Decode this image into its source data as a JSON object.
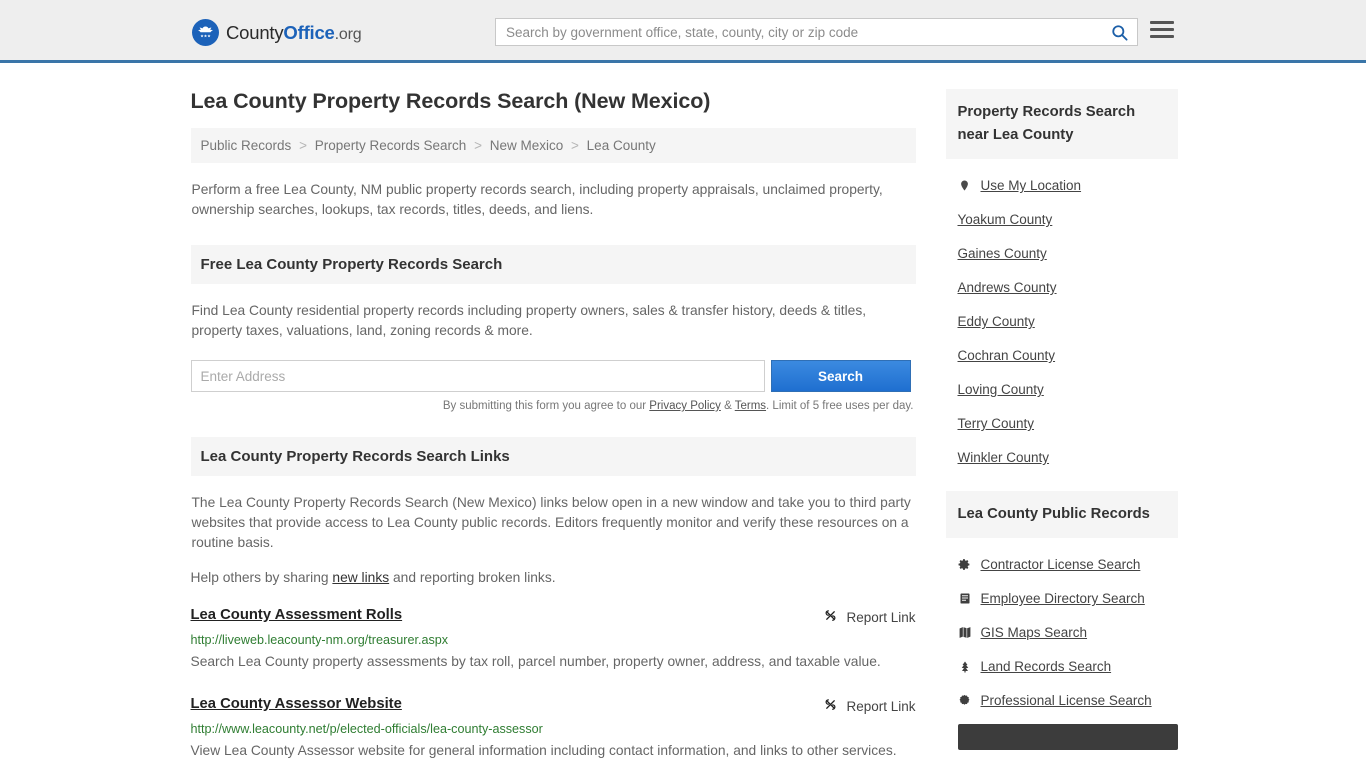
{
  "header": {
    "brand": {
      "part1": "County",
      "part2": "Office",
      "part3": ".org",
      "logo_icon": "eagle-seal-icon"
    },
    "search": {
      "placeholder": "Search by government office, state, county, city or zip code",
      "value": "",
      "icon": "search-icon"
    },
    "menu_icon": "hamburger-menu-icon"
  },
  "main": {
    "title": "Lea County Property Records Search (New Mexico)",
    "breadcrumb": [
      {
        "label": "Public Records"
      },
      {
        "label": "Property Records Search"
      },
      {
        "label": "New Mexico"
      },
      {
        "label": "Lea County"
      }
    ],
    "breadcrumb_separator": ">",
    "lede": "Perform a free Lea County, NM public property records search, including property appraisals, unclaimed property, ownership searches, lookups, tax records, titles, deeds, and liens.",
    "free_search": {
      "heading": "Free Lea County Property Records Search",
      "body": "Find Lea County residential property records including property owners, sales & transfer history, deeds & titles, property taxes, valuations, land, zoning records & more.",
      "input_placeholder": "Enter Address",
      "input_value": "",
      "submit_label": "Search",
      "note_prefix": "By submitting this form you agree to our ",
      "note_privacy": "Privacy Policy",
      "note_amp": " & ",
      "note_terms": "Terms",
      "note_suffix": ". Limit of 5 free uses per day."
    },
    "links_section": {
      "heading": "Lea County Property Records Search Links",
      "body": "The Lea County Property Records Search (New Mexico) links below open in a new window and take you to third party websites that provide access to Lea County public records. Editors frequently monitor and verify these resources on a routine basis.",
      "help_prefix": "Help others by sharing ",
      "help_link": "new links",
      "help_suffix": " and reporting broken links.",
      "report_label": "Report Link",
      "report_icon": "broken-link-icon",
      "results": [
        {
          "title": "Lea County Assessment Rolls",
          "url": "http://liveweb.leacounty-nm.org/treasurer.aspx",
          "description": "Search Lea County property assessments by tax roll, parcel number, property owner, address, and taxable value."
        },
        {
          "title": "Lea County Assessor Website",
          "url": "http://www.leacounty.net/p/elected-officials/lea-county-assessor",
          "description": "View Lea County Assessor website for general information including contact information, and links to other services."
        }
      ]
    }
  },
  "sidebar": {
    "nearby": {
      "heading": "Property Records Search near Lea County",
      "items": [
        {
          "label": "Use My Location",
          "icon": "map-pin-icon"
        },
        {
          "label": "Yoakum County",
          "icon": ""
        },
        {
          "label": "Gaines County",
          "icon": ""
        },
        {
          "label": "Andrews County",
          "icon": ""
        },
        {
          "label": "Eddy County",
          "icon": ""
        },
        {
          "label": "Cochran County",
          "icon": ""
        },
        {
          "label": "Loving County",
          "icon": ""
        },
        {
          "label": "Terry County",
          "icon": ""
        },
        {
          "label": "Winkler County",
          "icon": ""
        }
      ]
    },
    "public_records": {
      "heading": "Lea County Public Records",
      "items": [
        {
          "label": "Contractor License Search",
          "icon": "gear-icon"
        },
        {
          "label": "Employee Directory Search",
          "icon": "id-card-icon"
        },
        {
          "label": "GIS Maps Search",
          "icon": "map-icon"
        },
        {
          "label": "Land Records Search",
          "icon": "tree-icon"
        },
        {
          "label": "Professional License Search",
          "icon": "certificate-icon"
        }
      ]
    }
  },
  "colors": {
    "brand_blue": "#1c62b9",
    "header_border": "#3a75a8",
    "button_blue": "#1f6fd0",
    "url_green": "#2f7d32",
    "panel_gray": "#f5f5f5"
  }
}
